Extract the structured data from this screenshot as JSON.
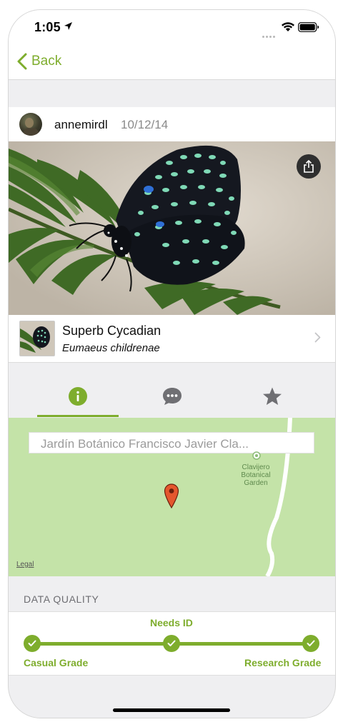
{
  "status_bar": {
    "time": "1:05"
  },
  "nav": {
    "back_label": "Back"
  },
  "observation": {
    "username": "annemirdl",
    "date": "10/12/14"
  },
  "taxon": {
    "common_name": "Superb Cycadian",
    "scientific_name": "Eumaeus childrenae"
  },
  "tabs": [
    {
      "id": "info",
      "icon": "info-icon",
      "active": true
    },
    {
      "id": "activity",
      "icon": "chat-bubble-icon",
      "active": false
    },
    {
      "id": "faves",
      "icon": "star-icon",
      "active": false
    }
  ],
  "map": {
    "place_guess": "Jardín Botánico Francisco Javier Cla...",
    "poi_label": "Clavijero Botanical Garden",
    "legal_label": "Legal"
  },
  "data_quality": {
    "section_title": "DATA QUALITY",
    "grades": [
      "Casual Grade",
      "Needs ID",
      "Research Grade"
    ],
    "current_grade": "Research Grade"
  },
  "colors": {
    "accent": "#7ead2d",
    "map_background": "#c4e3a8",
    "map_pin": "#e4572e"
  }
}
